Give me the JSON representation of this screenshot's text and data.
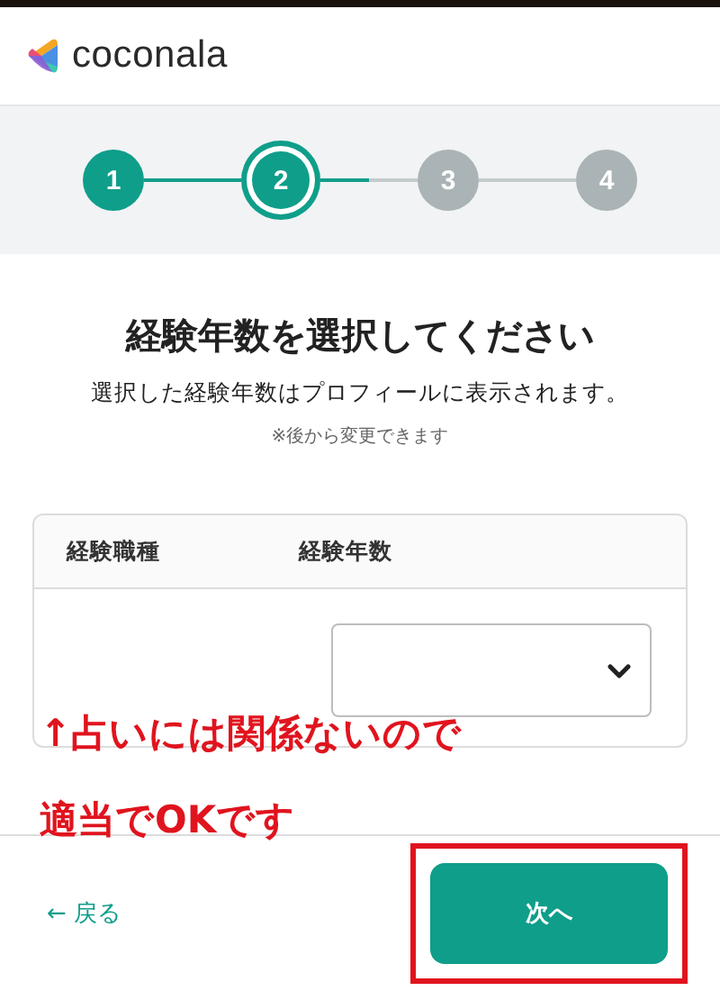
{
  "header": {
    "logo_text": "coconala"
  },
  "steps": [
    {
      "label": "1",
      "kind": "done"
    },
    {
      "label": "2",
      "kind": "current"
    },
    {
      "label": "3",
      "kind": "upcoming"
    },
    {
      "label": "4",
      "kind": "upcoming"
    }
  ],
  "title": "経験年数を選択してください",
  "subtitle": "選択した経験年数はプロフィールに表示されます。",
  "note": "※後から変更できます",
  "table": {
    "columns": [
      "経験職種",
      "経験年数"
    ]
  },
  "annotations": [
    "↑占いには関係ないので",
    "適当でOKです"
  ],
  "footer": {
    "back": "← 戻る",
    "next": "次へ",
    "next_highlighted": true
  }
}
